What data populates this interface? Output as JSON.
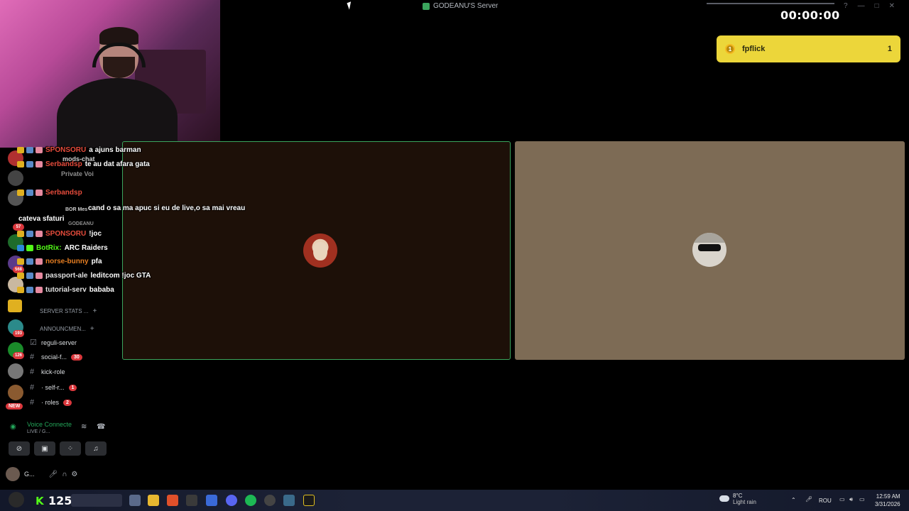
{
  "window": {
    "title": "GODEANU'S Server"
  },
  "stream_overlay": {
    "timer": "00:00:00",
    "alert": {
      "username": "fpflick",
      "count": "1",
      "color": "#ecd63a"
    },
    "viewer_count": "125",
    "kick_label": "K"
  },
  "chat": [
    {
      "user": "SPONSORU",
      "message": "a ajuns barman",
      "user_color": "#e74c3c"
    },
    {
      "user": "mods-chat",
      "message": "",
      "user_color": "#cfcfcf"
    },
    {
      "user": "Serbandsp",
      "message": "te au dat afara gata",
      "user_color": "#e74c3c"
    },
    {
      "user": "Private Voi",
      "message": "",
      "user_color": "#8e8e8e"
    },
    {
      "user": "Serbandsp",
      "message": "",
      "user_color": "#e74c3c"
    },
    {
      "user": "",
      "message": "cand o sa ma apuc si eu de live,o sa mai vreau",
      "user_color": "#e74c3c"
    },
    {
      "user": "BOR Mes",
      "message": "",
      "user_color": "#cfcfcf"
    },
    {
      "user": "cateva sfaturi",
      "message": "",
      "user_color": "#ffffff"
    },
    {
      "user": "GODEANU",
      "message": "",
      "user_color": "#8e8e8e"
    },
    {
      "user": "SPONSORU",
      "message": "!joc",
      "user_color": "#e74c3c"
    },
    {
      "user": "BotRix:",
      "message": "ARC Raiders",
      "user_color": "#53fc18"
    },
    {
      "user": "norse-bunny",
      "message": "pfa",
      "user_color": "#e67e22"
    },
    {
      "user": "passport-ale",
      "message": "leditcom !joc GTA",
      "user_color": "#e0e0e0"
    },
    {
      "user": "tutorial-serv",
      "message": "bababa",
      "user_color": "#e0e0e0"
    }
  ],
  "channels": [
    {
      "type": "category",
      "label": "SERVER STATS ..."
    },
    {
      "type": "category",
      "label": "ANNOUNCMEN..."
    },
    {
      "type": "text",
      "label": "reguli-server",
      "badge": ""
    },
    {
      "type": "text",
      "label": "social-f...",
      "badge": "30"
    },
    {
      "type": "text",
      "label": "kick-role",
      "badge": ""
    },
    {
      "type": "text",
      "label": "· self-r...",
      "badge": "1"
    },
    {
      "type": "text",
      "label": "· roles",
      "badge": "2"
    }
  ],
  "guild_badges": [
    "57",
    "568",
    "193",
    "126",
    "NEW"
  ],
  "voice_panel": {
    "status": "Voice Connecte",
    "sub": "LIVE / G..."
  },
  "user_panel": {
    "name": "G..."
  },
  "taskbar": {
    "weather_temp": "8°C",
    "weather_desc": "Light rain",
    "lang": "ROU",
    "time": "12:59 AM",
    "date": "3/31/2026"
  },
  "icons": {
    "coin": "coin-icon",
    "cloud": "cloud-icon",
    "hash": "hash-icon",
    "plus": "plus-icon",
    "gear": "gear-icon",
    "mic": "mic-icon",
    "headphones": "headphones-icon"
  }
}
